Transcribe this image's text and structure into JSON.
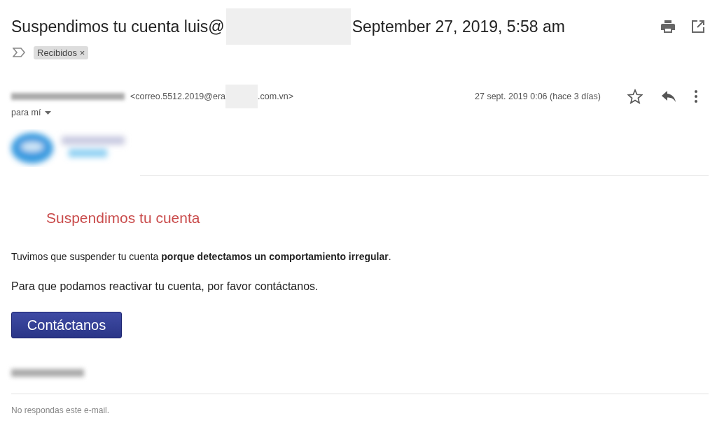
{
  "subject": {
    "prefix": "Suspendimos tu cuenta luis@",
    "suffix": "September 27, 2019, 5:58 am"
  },
  "labels": [
    {
      "text": "Recibidos",
      "remove": "×"
    }
  ],
  "message": {
    "email_start": "<correo.5512.2019@era",
    "email_end": ".com.vn>",
    "date": "27 sept. 2019 0:06 (hace 3 días)",
    "recipient": "para mí",
    "starred": false
  },
  "body": {
    "heading": "Suspendimos tu cuenta",
    "paragraphs": [
      "Tuvimos que suspender tu cuenta **porque detectamos un comportamiento irregular**.",
      "Para que podamos reactivar tu cuenta, por favor contáctanos."
    ],
    "button": "Contáctanos",
    "footer": "No respondas este e-mail."
  }
}
